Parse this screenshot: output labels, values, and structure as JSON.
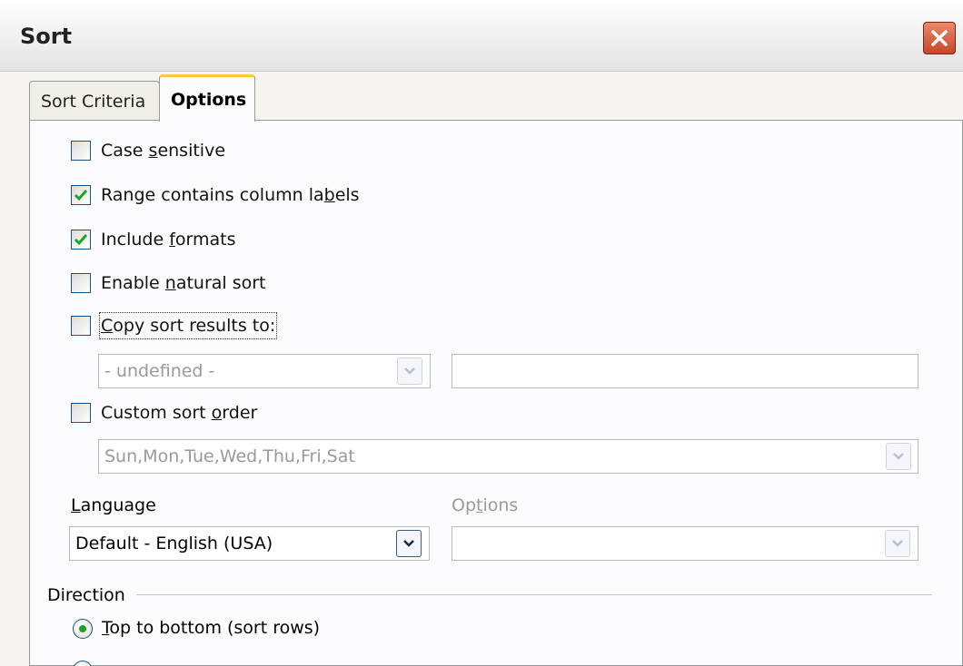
{
  "window": {
    "title": "Sort"
  },
  "tabs": [
    {
      "label": "Sort Criteria",
      "active": false
    },
    {
      "label": "Options",
      "active": true
    }
  ],
  "options": {
    "case_sensitive": {
      "label_pre": "Case ",
      "label_ul": "s",
      "label_post": "ensitive",
      "checked": false
    },
    "range_labels": {
      "label_pre": "Range contains column la",
      "label_ul": "b",
      "label_post": "els",
      "checked": true
    },
    "include_formats": {
      "label_pre": "Include ",
      "label_ul": "f",
      "label_post": "ormats",
      "checked": true
    },
    "natural_sort": {
      "label_pre": "Enable ",
      "label_ul": "n",
      "label_post": "atural sort",
      "checked": false
    },
    "copy_results": {
      "label_pre": "",
      "label_ul": "C",
      "label_post": "opy sort results to:",
      "checked": false
    },
    "copy_target_combo": {
      "value": "- undefined -"
    },
    "copy_target_input": {
      "value": ""
    },
    "custom_order": {
      "label_pre": "Custom sort ",
      "label_ul": "o",
      "label_post": "rder",
      "checked": false
    },
    "custom_order_combo": {
      "value": "Sun,Mon,Tue,Wed,Thu,Fri,Sat"
    },
    "language": {
      "label_ul": "L",
      "label_post": "anguage",
      "value": "Default - English (USA)"
    },
    "lang_options": {
      "label_pre": "Op",
      "label_ul": "t",
      "label_post": "ions",
      "value": ""
    }
  },
  "direction": {
    "label": "Direction",
    "top_to_bottom": {
      "label_ul": "T",
      "label_post": "op to bottom (sort rows)",
      "selected": true
    }
  },
  "colors": {
    "check": "#21a121",
    "tab_accent": "#ffc83c",
    "close": "#c8462b"
  }
}
